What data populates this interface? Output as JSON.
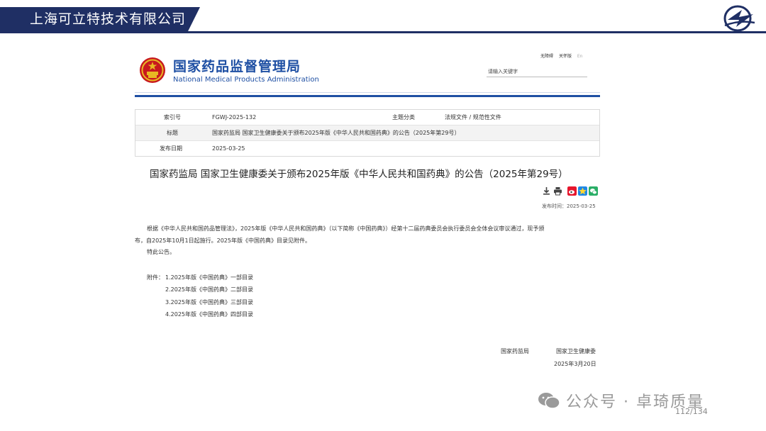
{
  "slide": {
    "company": "上海可立特技术有限公司",
    "page_number": "112/134",
    "watermark": "公众号 · 卓琦质量"
  },
  "site": {
    "name_cn": "国家药品监督管理局",
    "name_en": "National Medical Products Administration",
    "top_links": [
      "无障碍",
      "关怀版",
      "En"
    ],
    "search_placeholder": "请输入关键字"
  },
  "meta": {
    "index_label": "索引号",
    "index_value": "FGWJ-2025-132",
    "category_label": "主题分类",
    "category_value": "法规文件 / 规范性文件",
    "title_label": "标题",
    "title_value": "国家药监局 国家卫生健康委关于颁布2025年版《中华人民共和国药典》的公告（2025年第29号）",
    "date_label": "发布日期",
    "date_value": "2025-03-25"
  },
  "article": {
    "title": "国家药监局 国家卫生健康委关于颁布2025年版《中华人民共和国药典》的公告（2025年第29号）",
    "publish_time": "发布时间：2025-03-25",
    "body_line1": "根据《中华人民共和国药品管理法》，2025年版《中华人民共和国药典》（以下简称《中国药典》）经第十二届药典委员会执行委员会全体会议审议通过，现予颁",
    "body_line2": "布，自2025年10月1日起施行。2025年版《中国药典》目录见附件。",
    "body_line3": "特此公告。",
    "attachments_label": "附件：",
    "attachments": [
      "1.2025年版《中国药典》一部目录",
      "2.2025年版《中国药典》二部目录",
      "3.2025年版《中国药典》三部目录",
      "4.2025年版《中国药典》四部目录"
    ],
    "signer1": "国家药监局",
    "signer2": "国家卫生健康委",
    "sign_date": "2025年3月20日"
  },
  "icons": [
    "download-icon",
    "print-icon",
    "weibo-icon",
    "qzone-icon",
    "wechat-icon"
  ],
  "colors": {
    "banner": "#1f2f64",
    "site_blue": "#1e4fa3",
    "emblem_red": "#c8191e",
    "emblem_gold": "#e8b923"
  }
}
